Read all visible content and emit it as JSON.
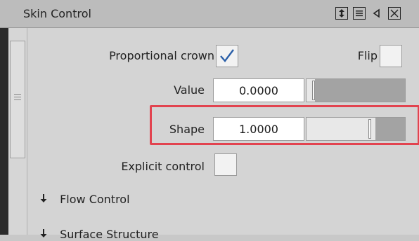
{
  "panel": {
    "title": "Skin Control",
    "toolbar_icons": [
      "resize-vertical-icon",
      "menu-icon",
      "collapse-left-icon",
      "close-icon"
    ]
  },
  "controls": {
    "proportional_crown": {
      "label": "Proportional crown",
      "checked": true
    },
    "flip": {
      "label": "Flip",
      "checked": false
    },
    "value": {
      "label": "Value",
      "value": "0.0000",
      "slider_fraction": 0.0
    },
    "shape": {
      "label": "Shape",
      "value": "1.0000",
      "slider_fraction": 1.0
    },
    "explicit_control": {
      "label": "Explicit control",
      "checked": false
    }
  },
  "sections": [
    {
      "label": "Flow Control",
      "icon": "arrow-down-icon"
    },
    {
      "label": "Surface Structure",
      "icon": "arrow-down-icon"
    }
  ],
  "colors": {
    "highlight": "#e2434f",
    "checkmark": "#2a5fa8"
  }
}
